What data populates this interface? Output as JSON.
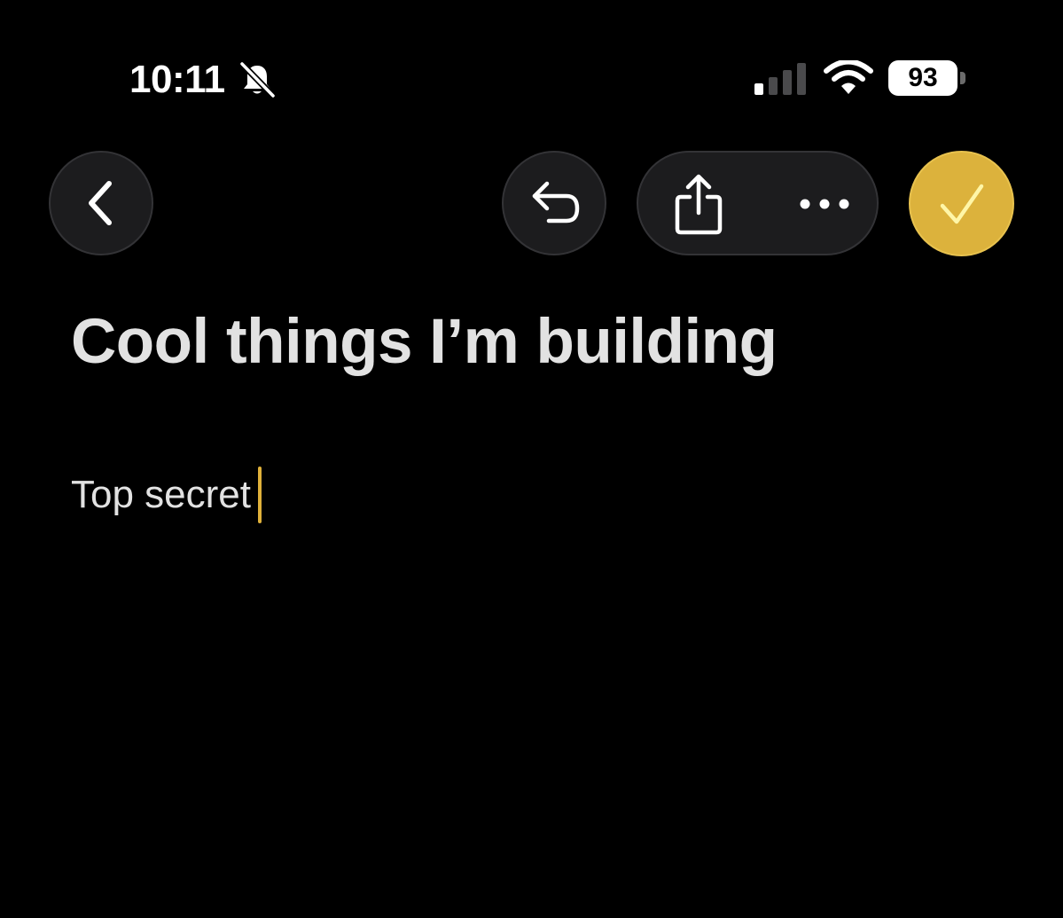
{
  "status_bar": {
    "time": "10:11",
    "battery_level": "93",
    "silent_mode_icon": "bell-slash-icon",
    "signal_icon": "cellular-signal-icon",
    "wifi_icon": "wifi-icon"
  },
  "toolbar": {
    "back_icon": "chevron-left-icon",
    "undo_icon": "undo-icon",
    "share_icon": "share-icon",
    "more_icon": "ellipsis-icon",
    "done_icon": "checkmark-icon",
    "accent_color": "#dcb23c"
  },
  "note": {
    "title": "Cool things I’m building",
    "body": "Top secret"
  }
}
